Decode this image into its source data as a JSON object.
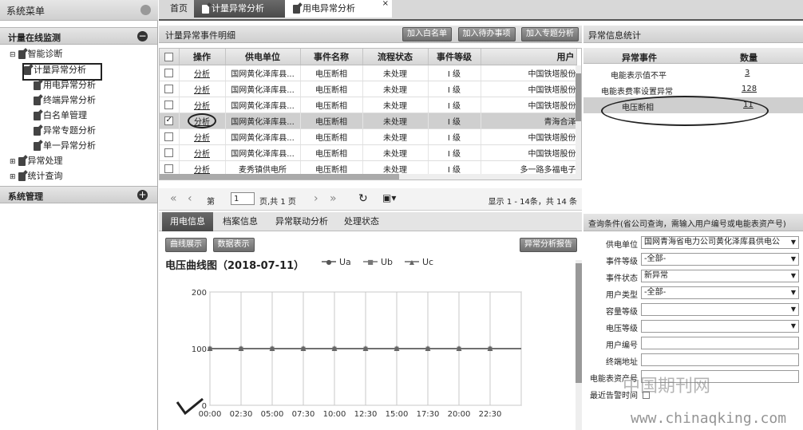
{
  "sidebar": {
    "title": "系统菜单",
    "section_monitor": "计量在线监测",
    "tree_items": [
      "智能诊断",
      "计量异常分析",
      "用电异常分析",
      "终端异常分析",
      "白名单管理",
      "异常专题分析",
      "单一异常分析",
      "异常处理",
      "统计查询"
    ],
    "section_system": "系统管理"
  },
  "tabs": [
    "首页",
    "计量异常分析",
    "用电异常分析"
  ],
  "details": {
    "title": "计量异常事件明细",
    "buttons": [
      "加入白名单",
      "加入待办事项",
      "加入专题分析"
    ],
    "columns": [
      "操作",
      "供电单位",
      "事件名称",
      "流程状态",
      "事件等级",
      "用户"
    ],
    "rows": [
      {
        "op": "分析",
        "unit": "国网黄化泽库县...",
        "event": "电压断相",
        "status": "未处理",
        "level": "I 级",
        "user": "中国铁塔股份"
      },
      {
        "op": "分析",
        "unit": "国网黄化泽库县...",
        "event": "电压断相",
        "status": "未处理",
        "level": "I 级",
        "user": "中国铁塔股份"
      },
      {
        "op": "分析",
        "unit": "国网黄化泽库县...",
        "event": "电压断相",
        "status": "未处理",
        "level": "I 级",
        "user": "中国铁塔股份"
      },
      {
        "op": "分析",
        "unit": "国网黄化泽库县...",
        "event": "电压断相",
        "status": "未处理",
        "level": "I 级",
        "user": "青海合泽"
      },
      {
        "op": "分析",
        "unit": "国网黄化泽库县...",
        "event": "电压断相",
        "status": "未处理",
        "level": "I 级",
        "user": "中国铁塔股份"
      },
      {
        "op": "分析",
        "unit": "国网黄化泽库县...",
        "event": "电压断相",
        "status": "未处理",
        "level": "I 级",
        "user": "中国铁塔股份"
      },
      {
        "op": "分析",
        "unit": "麦秀镇供电所",
        "event": "电压断相",
        "status": "未处理",
        "level": "I 级",
        "user": "多一路多福电子"
      }
    ],
    "pager": {
      "prefix": "第",
      "page": "1",
      "total": "页,共 1 页",
      "summary": "显示 1 - 14条，共 14 条"
    }
  },
  "stats": {
    "title": "异常信息统计",
    "columns": [
      "异常事件",
      "数量"
    ],
    "rows": [
      {
        "event": "电能表示值不平",
        "count": "3"
      },
      {
        "event": "电能表费率设置异常",
        "count": "128"
      },
      {
        "event": "电压断相",
        "count": "11"
      }
    ]
  },
  "info_tabs": [
    "用电信息",
    "档案信息",
    "异常联动分析",
    "处理状态"
  ],
  "chart_buttons": {
    "left": [
      "曲线展示",
      "数据表示"
    ],
    "right": "异常分析报告"
  },
  "query": {
    "title": "查询条件(省公司查询，需输入用户编号或电能表资产号)",
    "fields": [
      {
        "label": "供电单位",
        "value": "国网青海省电力公司黄化泽库县供电公",
        "type": "select"
      },
      {
        "label": "事件等级",
        "value": "-全部-",
        "type": "select"
      },
      {
        "label": "事件状态",
        "value": "新异常",
        "type": "select"
      },
      {
        "label": "用户类型",
        "value": "-全部-",
        "type": "select"
      },
      {
        "label": "容量等级",
        "value": "",
        "type": "select"
      },
      {
        "label": "电压等级",
        "value": "",
        "type": "select"
      },
      {
        "label": "用户编号",
        "value": "",
        "type": "text"
      },
      {
        "label": "终端地址",
        "value": "",
        "type": "text"
      },
      {
        "label": "电能表资产号",
        "value": "",
        "type": "text"
      }
    ],
    "last_alarm_label": "最近告警时间"
  },
  "watermark": {
    "cn": "中国期刊网",
    "url": "www.chinaqking.com"
  },
  "chart_data": {
    "type": "line",
    "title": "电压曲线图（2018-07-11）",
    "xlabel": "",
    "ylabel": "",
    "x": [
      "00:00",
      "02:30",
      "05:00",
      "07:30",
      "10:00",
      "12:30",
      "15:00",
      "17:30",
      "20:00",
      "22:30"
    ],
    "ylim": [
      0,
      200
    ],
    "yticks": [
      0,
      100,
      200
    ],
    "grid": true,
    "legend": "top",
    "series": [
      {
        "name": "Ua",
        "marker": "circle",
        "values": [
          100,
          100,
          100,
          100,
          100,
          100,
          100,
          100,
          100,
          100
        ]
      },
      {
        "name": "Ub",
        "marker": "square",
        "values": [
          100,
          100,
          100,
          100,
          100,
          100,
          100,
          100,
          100,
          100
        ]
      },
      {
        "name": "Uc",
        "marker": "triangle",
        "values": [
          100,
          100,
          100,
          100,
          100,
          100,
          100,
          100,
          100,
          100
        ]
      }
    ]
  }
}
